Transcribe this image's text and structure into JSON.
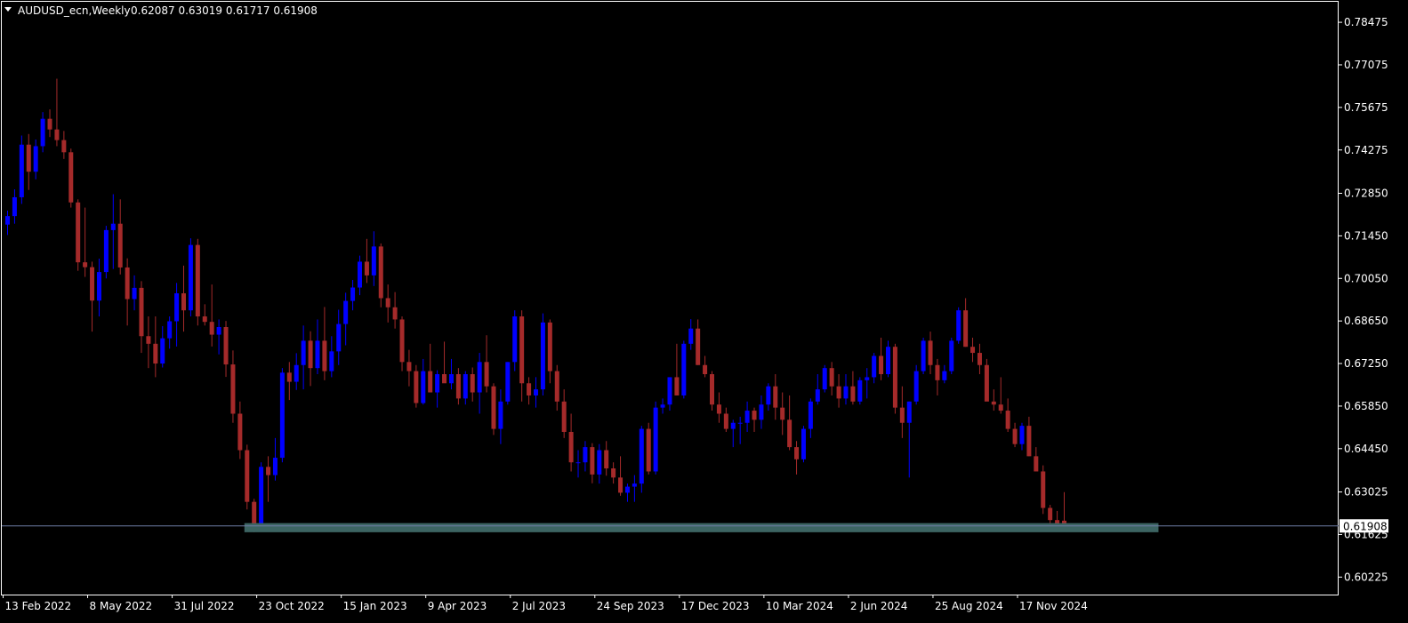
{
  "colors": {
    "background": "#000000",
    "frame": "#ffffff",
    "bull": "#0000ff",
    "bear": "#a52a2a",
    "zone": "#3c6462",
    "bid_line": "#6e7ca4",
    "text": "#ffffff"
  },
  "header": {
    "symbol_period": "AUDUSD_ecn,Weekly",
    "ohlc": "0.62087 0.63019 0.61717 0.61908",
    "menu_icon": "triangle-down-icon"
  },
  "chart_data": {
    "type": "candlestick",
    "symbol": "AUDUSD_ecn",
    "timeframe": "Weekly",
    "ylim": [
      0.5965,
      0.7915
    ],
    "y_ticks": [
      "0.78475",
      "0.77075",
      "0.75675",
      "0.74275",
      "0.72850",
      "0.71450",
      "0.70050",
      "0.68650",
      "0.67250",
      "0.65850",
      "0.64450",
      "0.63025",
      "0.61625",
      "0.60225"
    ],
    "x_ticks": [
      {
        "label": "13 Feb 2022",
        "bar": 0
      },
      {
        "label": "8 May 2022",
        "bar": 12
      },
      {
        "label": "31 Jul 2022",
        "bar": 24
      },
      {
        "label": "23 Oct 2022",
        "bar": 36
      },
      {
        "label": "15 Jan 2023",
        "bar": 48
      },
      {
        "label": "9 Apr 2023",
        "bar": 60
      },
      {
        "label": "2 Jul 2023",
        "bar": 72
      },
      {
        "label": "24 Sep 2023",
        "bar": 84
      },
      {
        "label": "17 Dec 2023",
        "bar": 96
      },
      {
        "label": "10 Mar 2024",
        "bar": 108
      },
      {
        "label": "2 Jun 2024",
        "bar": 120
      },
      {
        "label": "25 Aug 2024",
        "bar": 132
      },
      {
        "label": "17 Nov 2024",
        "bar": 144
      }
    ],
    "bid_price": "0.61908",
    "bid_value": 0.61908,
    "support_zone": {
      "top": 0.62,
      "bottom": 0.617,
      "start_bar": 34,
      "end_bar": 163
    },
    "candles": [
      [
        0.7182,
        0.7228,
        0.7148,
        0.721
      ],
      [
        0.721,
        0.7298,
        0.7185,
        0.7272
      ],
      [
        0.7272,
        0.7475,
        0.725,
        0.7445
      ],
      [
        0.7445,
        0.748,
        0.7296,
        0.7356
      ],
      [
        0.7356,
        0.7462,
        0.7331,
        0.744
      ],
      [
        0.744,
        0.7552,
        0.742,
        0.753
      ],
      [
        0.753,
        0.7561,
        0.747,
        0.7495
      ],
      [
        0.7495,
        0.7662,
        0.744,
        0.746
      ],
      [
        0.746,
        0.749,
        0.7398,
        0.742
      ],
      [
        0.742,
        0.7432,
        0.7238,
        0.7255
      ],
      [
        0.7255,
        0.7265,
        0.703,
        0.7058
      ],
      [
        0.7058,
        0.7238,
        0.701,
        0.7042
      ],
      [
        0.7042,
        0.706,
        0.683,
        0.6932
      ],
      [
        0.6932,
        0.707,
        0.688,
        0.7026
      ],
      [
        0.7026,
        0.7178,
        0.7005,
        0.7164
      ],
      [
        0.7164,
        0.7282,
        0.7036,
        0.7185
      ],
      [
        0.7185,
        0.7265,
        0.7018,
        0.7041
      ],
      [
        0.7041,
        0.7071,
        0.685,
        0.6937
      ],
      [
        0.6937,
        0.7015,
        0.69,
        0.6974
      ],
      [
        0.6974,
        0.6996,
        0.676,
        0.6815
      ],
      [
        0.6815,
        0.688,
        0.671,
        0.679
      ],
      [
        0.679,
        0.688,
        0.668,
        0.6725
      ],
      [
        0.6725,
        0.6848,
        0.6712,
        0.6808
      ],
      [
        0.6808,
        0.688,
        0.6774,
        0.6864
      ],
      [
        0.6864,
        0.699,
        0.6781,
        0.6956
      ],
      [
        0.6956,
        0.7047,
        0.683,
        0.69
      ],
      [
        0.69,
        0.7137,
        0.688,
        0.7115
      ],
      [
        0.7115,
        0.7135,
        0.685,
        0.688
      ],
      [
        0.688,
        0.692,
        0.685,
        0.6862
      ],
      [
        0.6862,
        0.6985,
        0.6781,
        0.682
      ],
      [
        0.682,
        0.687,
        0.6755,
        0.6845
      ],
      [
        0.6845,
        0.6865,
        0.6681,
        0.6722
      ],
      [
        0.6722,
        0.6768,
        0.653,
        0.656
      ],
      [
        0.656,
        0.66,
        0.6411,
        0.644
      ],
      [
        0.644,
        0.6458,
        0.6245,
        0.627
      ],
      [
        0.627,
        0.628,
        0.617,
        0.6185
      ],
      [
        0.6185,
        0.64,
        0.6175,
        0.6385
      ],
      [
        0.6385,
        0.642,
        0.627,
        0.6358
      ],
      [
        0.6358,
        0.648,
        0.634,
        0.6415
      ],
      [
        0.6415,
        0.671,
        0.64,
        0.6695
      ],
      [
        0.6695,
        0.673,
        0.6605,
        0.6665
      ],
      [
        0.6665,
        0.6759,
        0.6638,
        0.672
      ],
      [
        0.672,
        0.685,
        0.664,
        0.68
      ],
      [
        0.68,
        0.6831,
        0.6651,
        0.671
      ],
      [
        0.671,
        0.687,
        0.669,
        0.68
      ],
      [
        0.68,
        0.6911,
        0.667,
        0.67
      ],
      [
        0.67,
        0.6815,
        0.668,
        0.6765
      ],
      [
        0.6765,
        0.6902,
        0.672,
        0.6855
      ],
      [
        0.6855,
        0.6958,
        0.6785,
        0.6931
      ],
      [
        0.6931,
        0.7,
        0.69,
        0.6975
      ],
      [
        0.6975,
        0.708,
        0.695,
        0.706
      ],
      [
        0.706,
        0.7135,
        0.699,
        0.7015
      ],
      [
        0.7015,
        0.716,
        0.698,
        0.711
      ],
      [
        0.711,
        0.712,
        0.691,
        0.694
      ],
      [
        0.694,
        0.6985,
        0.686,
        0.691
      ],
      [
        0.691,
        0.696,
        0.684,
        0.687
      ],
      [
        0.687,
        0.688,
        0.67,
        0.673
      ],
      [
        0.673,
        0.677,
        0.665,
        0.67
      ],
      [
        0.67,
        0.672,
        0.658,
        0.6595
      ],
      [
        0.6595,
        0.674,
        0.659,
        0.67
      ],
      [
        0.67,
        0.679,
        0.663,
        0.663
      ],
      [
        0.663,
        0.6703,
        0.658,
        0.669
      ],
      [
        0.669,
        0.6797,
        0.668,
        0.666
      ],
      [
        0.666,
        0.674,
        0.664,
        0.669
      ],
      [
        0.669,
        0.671,
        0.659,
        0.661
      ],
      [
        0.661,
        0.67,
        0.659,
        0.669
      ],
      [
        0.669,
        0.6712,
        0.66,
        0.663
      ],
      [
        0.663,
        0.676,
        0.656,
        0.673
      ],
      [
        0.673,
        0.6818,
        0.663,
        0.665
      ],
      [
        0.665,
        0.666,
        0.649,
        0.651
      ],
      [
        0.651,
        0.664,
        0.646,
        0.66
      ],
      [
        0.66,
        0.673,
        0.659,
        0.673
      ],
      [
        0.673,
        0.69,
        0.67,
        0.688
      ],
      [
        0.688,
        0.69,
        0.66,
        0.666
      ],
      [
        0.666,
        0.668,
        0.659,
        0.662
      ],
      [
        0.662,
        0.668,
        0.658,
        0.664
      ],
      [
        0.664,
        0.689,
        0.662,
        0.686
      ],
      [
        0.686,
        0.687,
        0.666,
        0.67
      ],
      [
        0.67,
        0.672,
        0.657,
        0.66
      ],
      [
        0.66,
        0.664,
        0.648,
        0.65
      ],
      [
        0.65,
        0.656,
        0.637,
        0.64
      ],
      [
        0.64,
        0.644,
        0.635,
        0.64
      ],
      [
        0.64,
        0.647,
        0.637,
        0.645
      ],
      [
        0.645,
        0.6463,
        0.6331,
        0.636
      ],
      [
        0.636,
        0.646,
        0.633,
        0.644
      ],
      [
        0.644,
        0.647,
        0.6356,
        0.638
      ],
      [
        0.638,
        0.64,
        0.633,
        0.635
      ],
      [
        0.635,
        0.642,
        0.629,
        0.63
      ],
      [
        0.63,
        0.633,
        0.627,
        0.632
      ],
      [
        0.632,
        0.6358,
        0.627,
        0.633
      ],
      [
        0.633,
        0.652,
        0.63,
        0.651
      ],
      [
        0.651,
        0.653,
        0.636,
        0.637
      ],
      [
        0.637,
        0.66,
        0.636,
        0.658
      ],
      [
        0.658,
        0.661,
        0.656,
        0.659
      ],
      [
        0.659,
        0.668,
        0.657,
        0.668
      ],
      [
        0.668,
        0.679,
        0.662,
        0.662
      ],
      [
        0.662,
        0.68,
        0.661,
        0.679
      ],
      [
        0.679,
        0.6871,
        0.677,
        0.684
      ],
      [
        0.684,
        0.687,
        0.672,
        0.672
      ],
      [
        0.672,
        0.675,
        0.668,
        0.669
      ],
      [
        0.669,
        0.67,
        0.657,
        0.659
      ],
      [
        0.659,
        0.663,
        0.653,
        0.656
      ],
      [
        0.656,
        0.658,
        0.65,
        0.651
      ],
      [
        0.651,
        0.654,
        0.645,
        0.653
      ],
      [
        0.653,
        0.655,
        0.646,
        0.653
      ],
      [
        0.653,
        0.66,
        0.65,
        0.657
      ],
      [
        0.657,
        0.658,
        0.65,
        0.654
      ],
      [
        0.654,
        0.662,
        0.651,
        0.659
      ],
      [
        0.659,
        0.666,
        0.657,
        0.665
      ],
      [
        0.665,
        0.669,
        0.654,
        0.658
      ],
      [
        0.658,
        0.663,
        0.649,
        0.654
      ],
      [
        0.654,
        0.662,
        0.644,
        0.645
      ],
      [
        0.645,
        0.647,
        0.636,
        0.641
      ],
      [
        0.641,
        0.652,
        0.64,
        0.651
      ],
      [
        0.651,
        0.661,
        0.648,
        0.66
      ],
      [
        0.66,
        0.669,
        0.659,
        0.664
      ],
      [
        0.664,
        0.672,
        0.663,
        0.671
      ],
      [
        0.671,
        0.673,
        0.662,
        0.665
      ],
      [
        0.665,
        0.669,
        0.658,
        0.661
      ],
      [
        0.661,
        0.669,
        0.659,
        0.665
      ],
      [
        0.665,
        0.67,
        0.659,
        0.66
      ],
      [
        0.66,
        0.668,
        0.659,
        0.667
      ],
      [
        0.667,
        0.671,
        0.661,
        0.668
      ],
      [
        0.668,
        0.676,
        0.666,
        0.675
      ],
      [
        0.675,
        0.681,
        0.667,
        0.669
      ],
      [
        0.669,
        0.68,
        0.668,
        0.678
      ],
      [
        0.678,
        0.679,
        0.656,
        0.658
      ],
      [
        0.658,
        0.665,
        0.648,
        0.653
      ],
      [
        0.653,
        0.66,
        0.635,
        0.66
      ],
      [
        0.66,
        0.672,
        0.659,
        0.67
      ],
      [
        0.67,
        0.681,
        0.669,
        0.68
      ],
      [
        0.68,
        0.683,
        0.669,
        0.672
      ],
      [
        0.672,
        0.674,
        0.662,
        0.667
      ],
      [
        0.667,
        0.672,
        0.666,
        0.67
      ],
      [
        0.67,
        0.681,
        0.669,
        0.68
      ],
      [
        0.68,
        0.691,
        0.679,
        0.69
      ],
      [
        0.69,
        0.694,
        0.678,
        0.678
      ],
      [
        0.678,
        0.681,
        0.673,
        0.676
      ],
      [
        0.676,
        0.679,
        0.669,
        0.672
      ],
      [
        0.672,
        0.674,
        0.661,
        0.66
      ],
      [
        0.66,
        0.664,
        0.657,
        0.659
      ],
      [
        0.659,
        0.668,
        0.656,
        0.657
      ],
      [
        0.657,
        0.661,
        0.65,
        0.651
      ],
      [
        0.651,
        0.653,
        0.645,
        0.646
      ],
      [
        0.646,
        0.653,
        0.644,
        0.652
      ],
      [
        0.652,
        0.655,
        0.642,
        0.642
      ],
      [
        0.642,
        0.645,
        0.637,
        0.637
      ],
      [
        0.637,
        0.639,
        0.623,
        0.625
      ],
      [
        0.625,
        0.626,
        0.618,
        0.621
      ],
      [
        0.621,
        0.624,
        0.618,
        0.619
      ],
      [
        0.6208,
        0.6302,
        0.6172,
        0.6191
      ]
    ]
  }
}
